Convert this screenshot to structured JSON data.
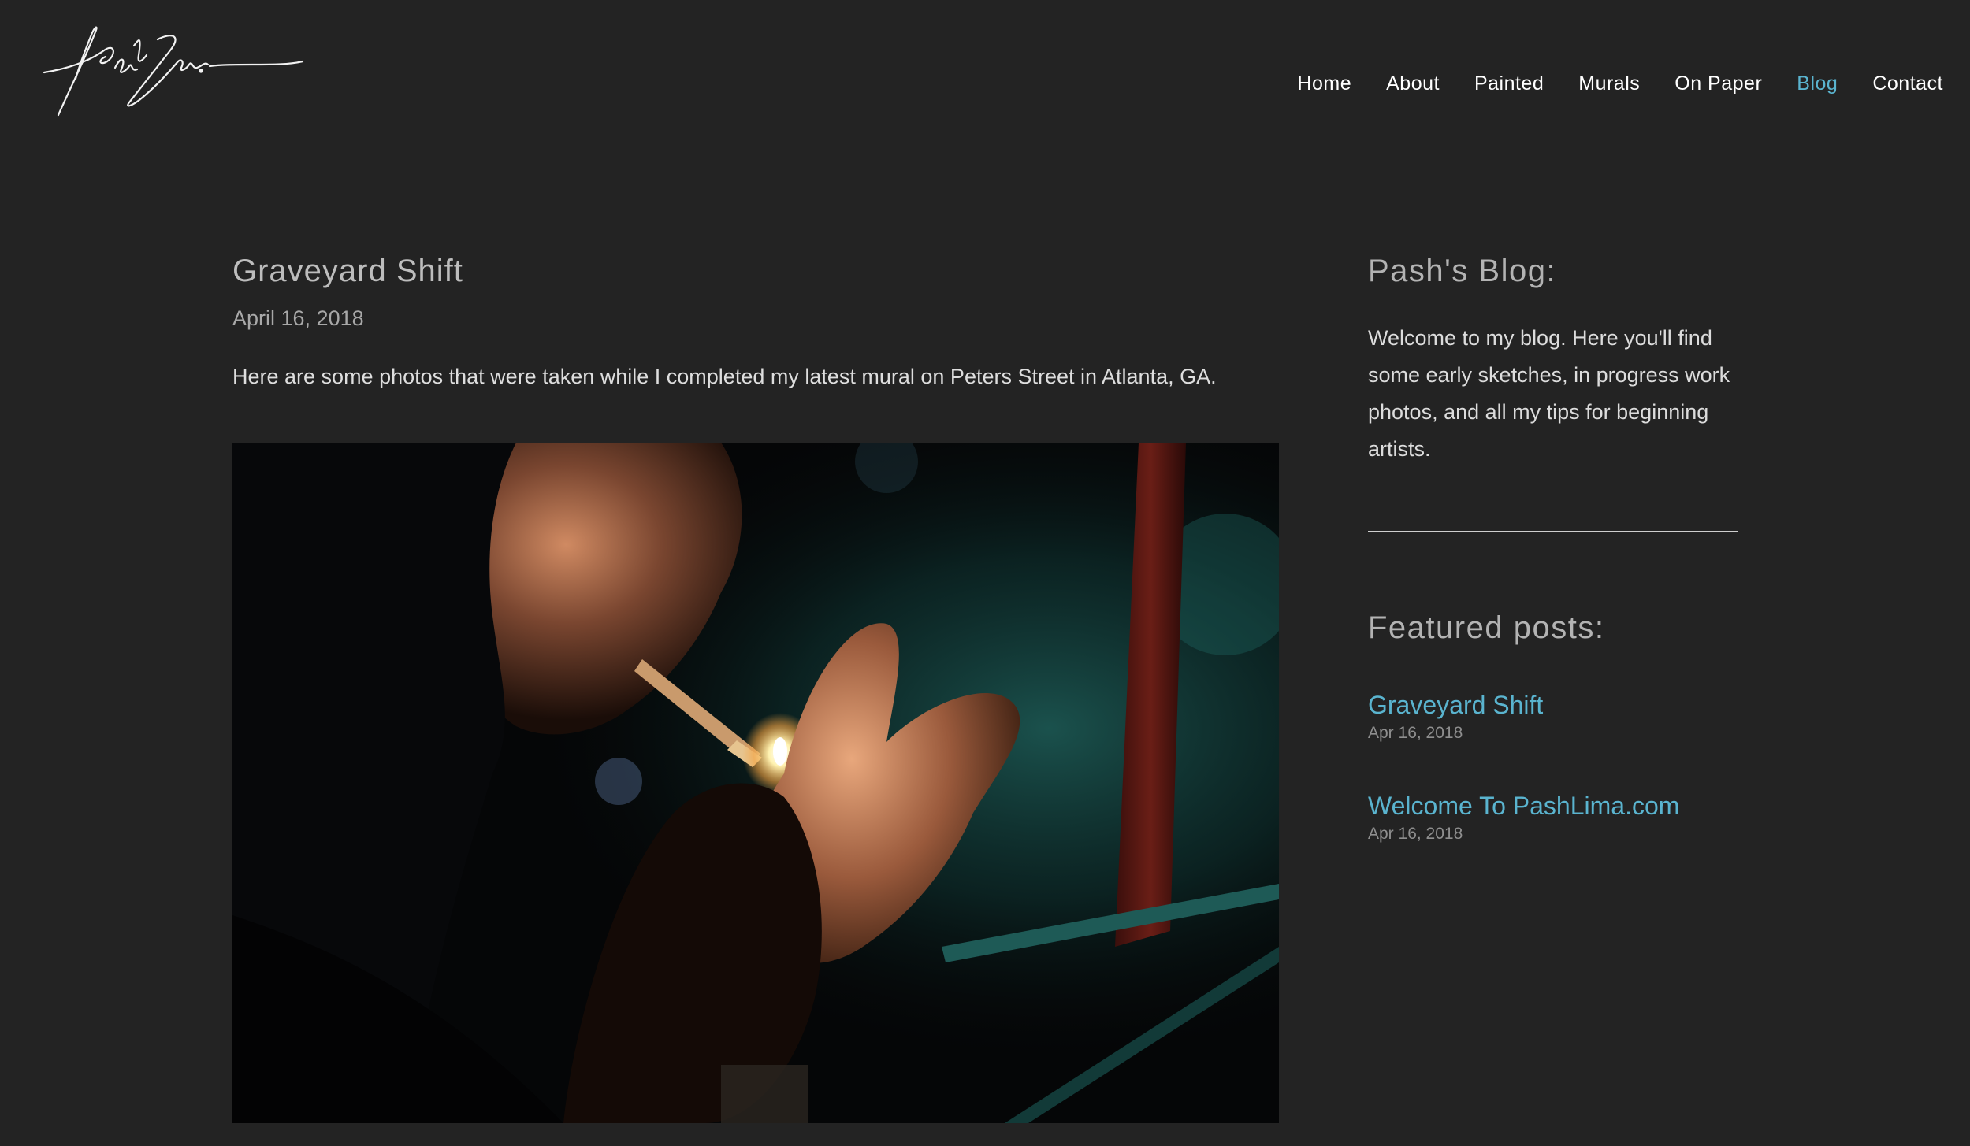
{
  "site": {
    "logo_alt": "Pash Lima"
  },
  "nav": {
    "items": [
      {
        "label": "Home",
        "active": false
      },
      {
        "label": "About",
        "active": false
      },
      {
        "label": "Painted",
        "active": false
      },
      {
        "label": "Murals",
        "active": false
      },
      {
        "label": "On Paper",
        "active": false
      },
      {
        "label": "Blog",
        "active": true
      },
      {
        "label": "Contact",
        "active": false
      }
    ]
  },
  "post": {
    "title": "Graveyard Shift",
    "date": "April 16, 2018",
    "body": "Here are some photos that were taken while I completed my latest mural on Peters Street in Atlanta, GA."
  },
  "sidebar": {
    "heading": "Pash's Blog:",
    "intro": "Welcome to my blog. Here you'll find some early sketches, in progress work photos, and all my tips for beginning artists.",
    "featured_heading": "Featured posts:",
    "featured": [
      {
        "title": "Graveyard Shift",
        "date": "Apr 16, 2018"
      },
      {
        "title": "Welcome To PashLima.com",
        "date": "Apr 16, 2018"
      }
    ]
  },
  "colors": {
    "background": "#232323",
    "accent": "#5ab4cf",
    "text": "#e6e6e6"
  }
}
